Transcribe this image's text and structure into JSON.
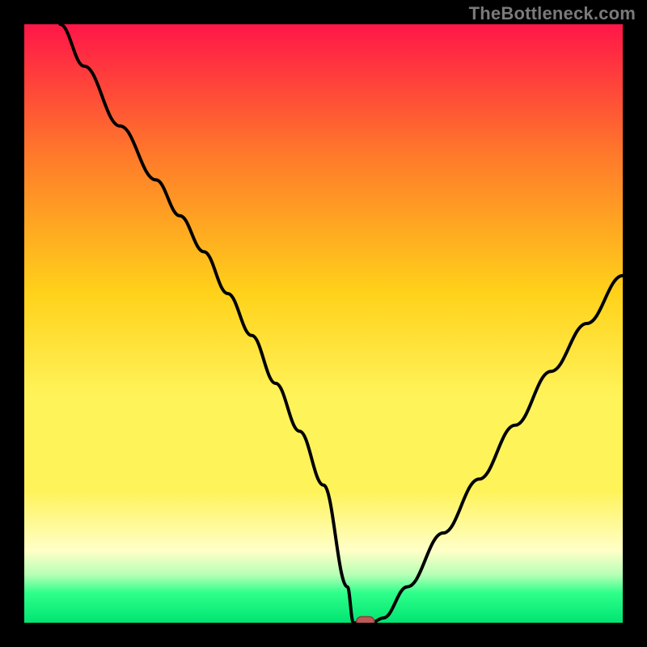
{
  "watermark": "TheBottleneck.com",
  "colors": {
    "frame": "#000000",
    "curve": "#000000",
    "marker_fill": "#bb5a55",
    "marker_stroke": "#8a3f3b",
    "gradient_top": "#ff1648",
    "gradient_mid1": "#ff7a2a",
    "gradient_mid2": "#ffd21a",
    "gradient_mid3": "#fff35a",
    "gradient_pale": "#ffffc8",
    "gradient_green1": "#b6ffb6",
    "gradient_green2": "#2fff8a",
    "gradient_bottom": "#00e472"
  },
  "chart_data": {
    "type": "line",
    "title": "",
    "xlabel": "",
    "ylabel": "",
    "xlim": [
      0,
      100
    ],
    "ylim": [
      0,
      100
    ],
    "legend": false,
    "grid": false,
    "series": [
      {
        "name": "bottleneck-curve",
        "x": [
          6,
          10,
          16,
          22,
          26,
          30,
          34,
          38,
          42,
          46,
          50,
          54,
          55,
          56,
          58,
          60,
          64,
          70,
          76,
          82,
          88,
          94,
          100
        ],
        "y": [
          100,
          93,
          83,
          74,
          68,
          62,
          55,
          48,
          40,
          32,
          23,
          6,
          0,
          0,
          0,
          0.8,
          6,
          15,
          24,
          33,
          42,
          50,
          58
        ]
      }
    ],
    "marker": {
      "x": 57,
      "y": 0.2,
      "shape": "pill"
    },
    "background": "vertical-gradient"
  }
}
